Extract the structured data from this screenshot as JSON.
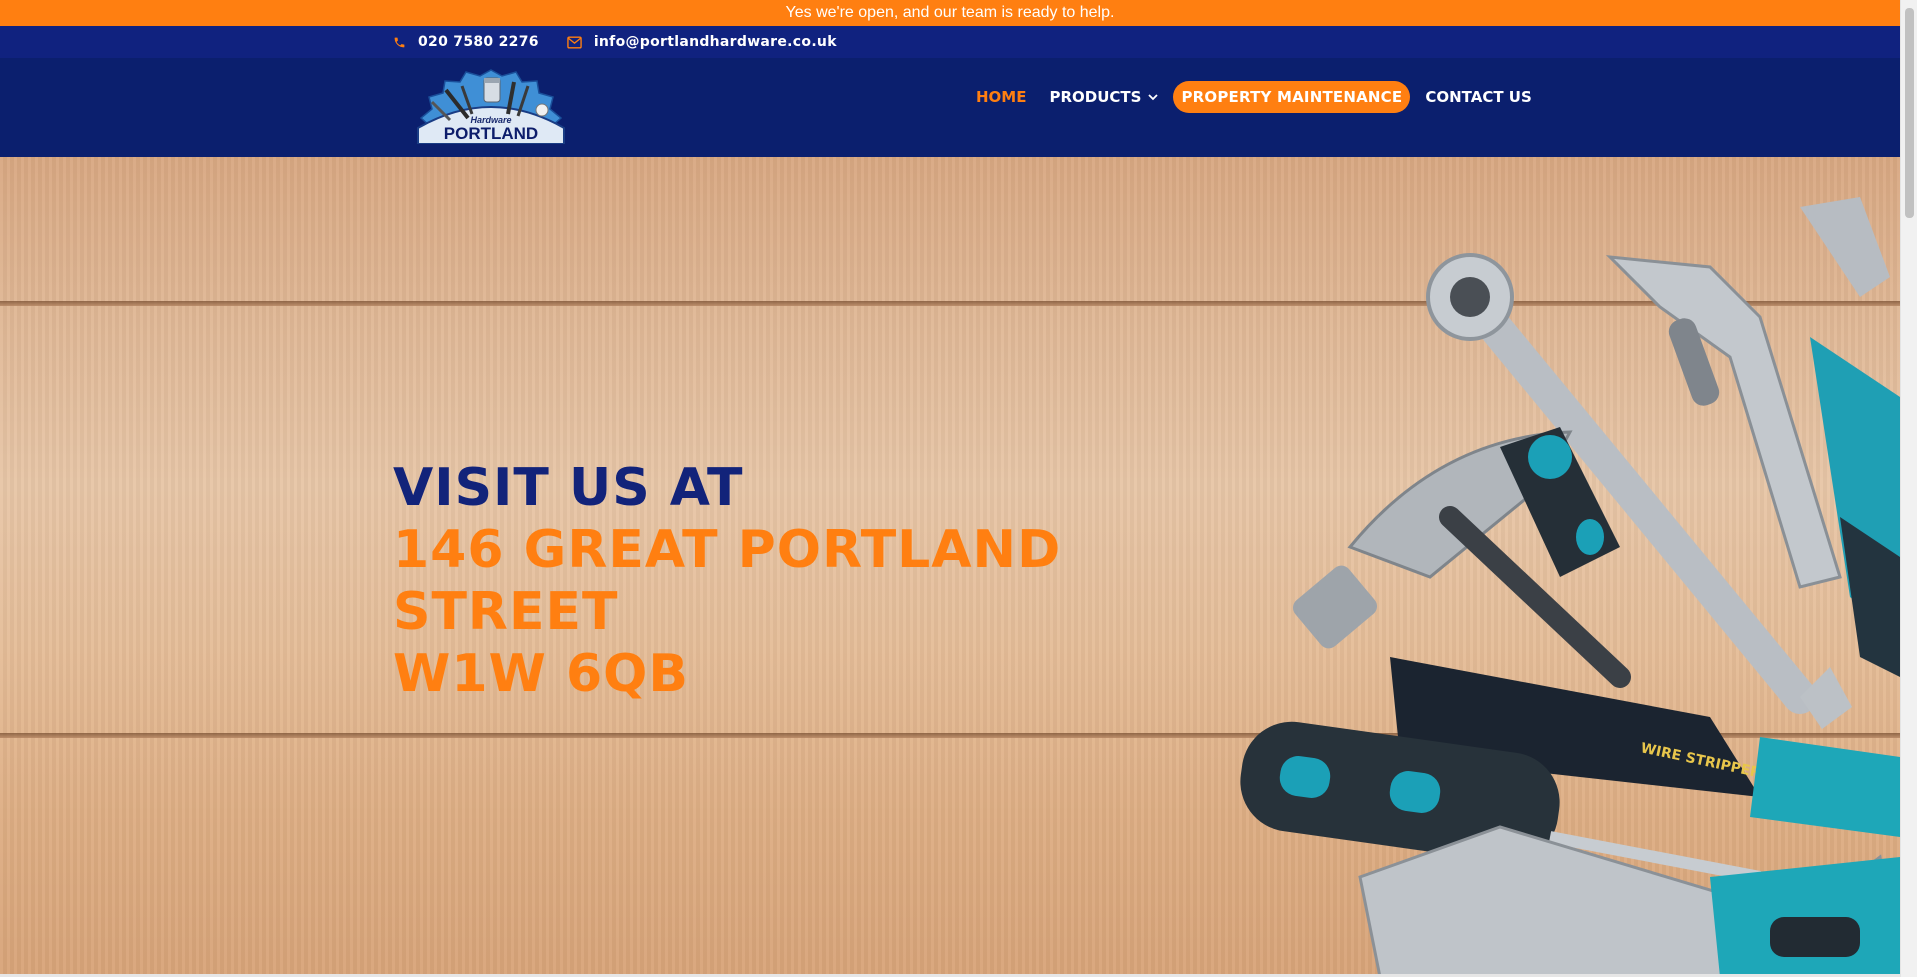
{
  "announcement": {
    "text": "Yes we're open, and our team is ready to help."
  },
  "contact": {
    "phone": "020 7580 2276",
    "email": "info@portlandhardware.co.uk"
  },
  "logo": {
    "small_text": "Hardware",
    "name": "PORTLAND"
  },
  "nav": {
    "items": [
      {
        "label": "HOME",
        "active": true
      },
      {
        "label": "PRODUCTS",
        "has_dropdown": true
      },
      {
        "label": "PROPERTY MAINTENANCE",
        "highlight": true
      },
      {
        "label": "CONTACT US"
      }
    ]
  },
  "hero": {
    "line1": "VISIT US AT",
    "line2": "146 GREAT PORTLAND",
    "line3": "STREET",
    "line4": "W1W 6QB"
  },
  "colors": {
    "accent_orange": "#ff7f11",
    "navy": "#0b1f6e",
    "navy_text": "#12237a"
  }
}
